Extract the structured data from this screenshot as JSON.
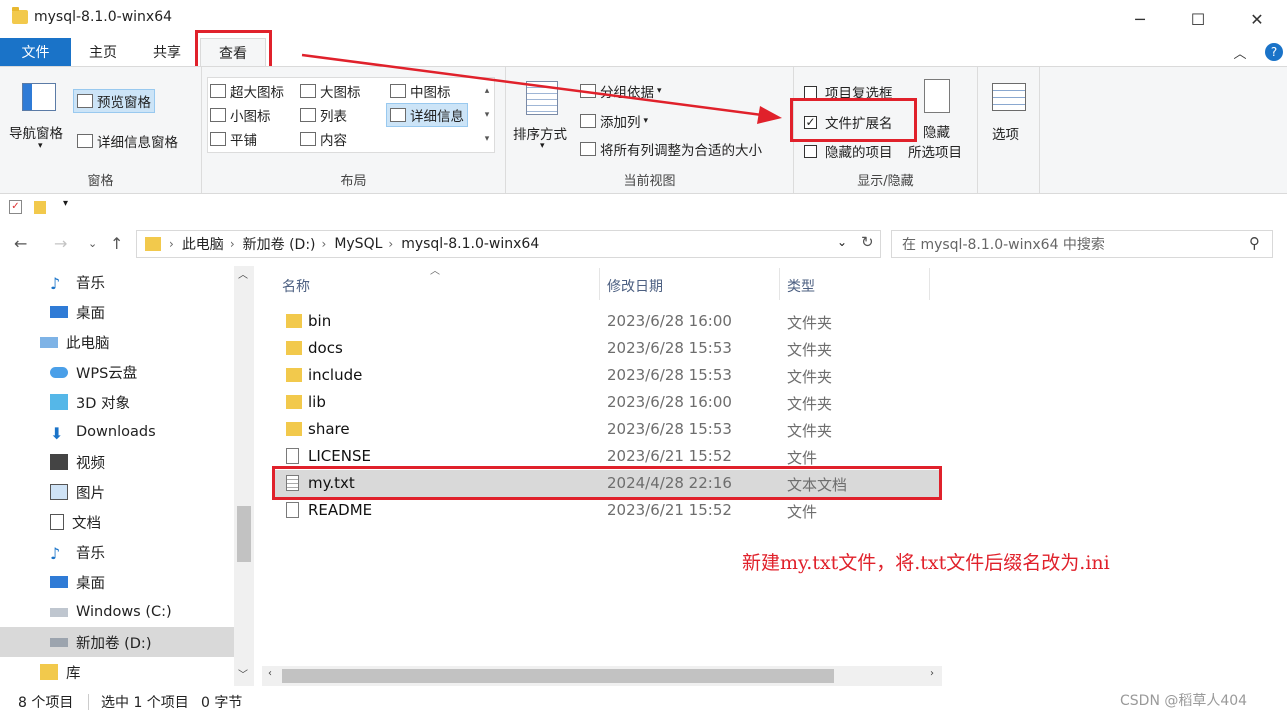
{
  "window": {
    "title": "mysql-8.1.0-winx64",
    "minimize": "─",
    "maximize": "☐",
    "close": "✕"
  },
  "ribbon_tabs": [
    "文件",
    "主页",
    "共享",
    "查看"
  ],
  "ribbon": {
    "panes": {
      "nav_pane": "导航窗格",
      "preview_pane": "预览窗格",
      "details_pane": "详细信息窗格",
      "label": "窗格"
    },
    "layout": {
      "items": [
        "超大图标",
        "大图标",
        "中图标",
        "小图标",
        "列表",
        "详细信息",
        "平铺",
        "内容"
      ],
      "label": "布局"
    },
    "current_view": {
      "sort": "排序方式",
      "group_by": "分组依据",
      "add_column": "添加列",
      "fit_columns": "将所有列调整为合适的大小",
      "label": "当前视图"
    },
    "show_hide": {
      "item_checkboxes": "项目复选框",
      "file_extensions": "文件扩展名",
      "hidden_items": "隐藏的项目",
      "hide_selected_1": "隐藏",
      "hide_selected_2": "所选项目",
      "label": "显示/隐藏",
      "file_extensions_checked": true,
      "item_checkboxes_checked": false,
      "hidden_items_checked": false
    },
    "options": "选项"
  },
  "breadcrumb": [
    "此电脑",
    "新加卷 (D:)",
    "MySQL",
    "mysql-8.1.0-winx64"
  ],
  "search": {
    "placeholder": "在 mysql-8.1.0-winx64 中搜索"
  },
  "nav_pane": [
    {
      "label": "音乐",
      "icon": "music-icon"
    },
    {
      "label": "桌面",
      "icon": "desktop-icon"
    },
    {
      "label": "此电脑",
      "icon": "computer-icon"
    },
    {
      "label": "WPS云盘",
      "icon": "cloud-icon"
    },
    {
      "label": "3D 对象",
      "icon": "cube-icon"
    },
    {
      "label": "Downloads",
      "icon": "download-icon"
    },
    {
      "label": "视频",
      "icon": "video-icon"
    },
    {
      "label": "图片",
      "icon": "picture-icon"
    },
    {
      "label": "文档",
      "icon": "document-icon"
    },
    {
      "label": "音乐",
      "icon": "music-icon"
    },
    {
      "label": "桌面",
      "icon": "desktop-icon"
    },
    {
      "label": "Windows (C:)",
      "icon": "drive-icon"
    },
    {
      "label": "新加卷 (D:)",
      "icon": "drive-icon"
    },
    {
      "label": "库",
      "icon": "library-icon"
    }
  ],
  "columns": {
    "name": "名称",
    "date": "修改日期",
    "type": "类型"
  },
  "files": [
    {
      "name": "bin",
      "date": "2023/6/28 16:00",
      "type": "文件夹",
      "kind": "folder"
    },
    {
      "name": "docs",
      "date": "2023/6/28 15:53",
      "type": "文件夹",
      "kind": "folder"
    },
    {
      "name": "include",
      "date": "2023/6/28 15:53",
      "type": "文件夹",
      "kind": "folder"
    },
    {
      "name": "lib",
      "date": "2023/6/28 16:00",
      "type": "文件夹",
      "kind": "folder"
    },
    {
      "name": "share",
      "date": "2023/6/28 15:53",
      "type": "文件夹",
      "kind": "folder"
    },
    {
      "name": "LICENSE",
      "date": "2023/6/21 15:52",
      "type": "文件",
      "kind": "file"
    },
    {
      "name": "my.txt",
      "date": "2024/4/28 22:16",
      "type": "文本文档",
      "kind": "text"
    },
    {
      "name": "README",
      "date": "2023/6/21 15:52",
      "type": "文件",
      "kind": "file"
    }
  ],
  "status": {
    "count": "8 个项目",
    "selected": "选中 1 个项目",
    "size": "0 字节"
  },
  "annotation": "新建my.txt文件，将.txt文件后缀名改为.ini",
  "watermark": "CSDN @稻草人404",
  "colors": {
    "accent": "#1a73c8",
    "highlight_box": "#e0212b",
    "selection": "#d9d9d9"
  }
}
